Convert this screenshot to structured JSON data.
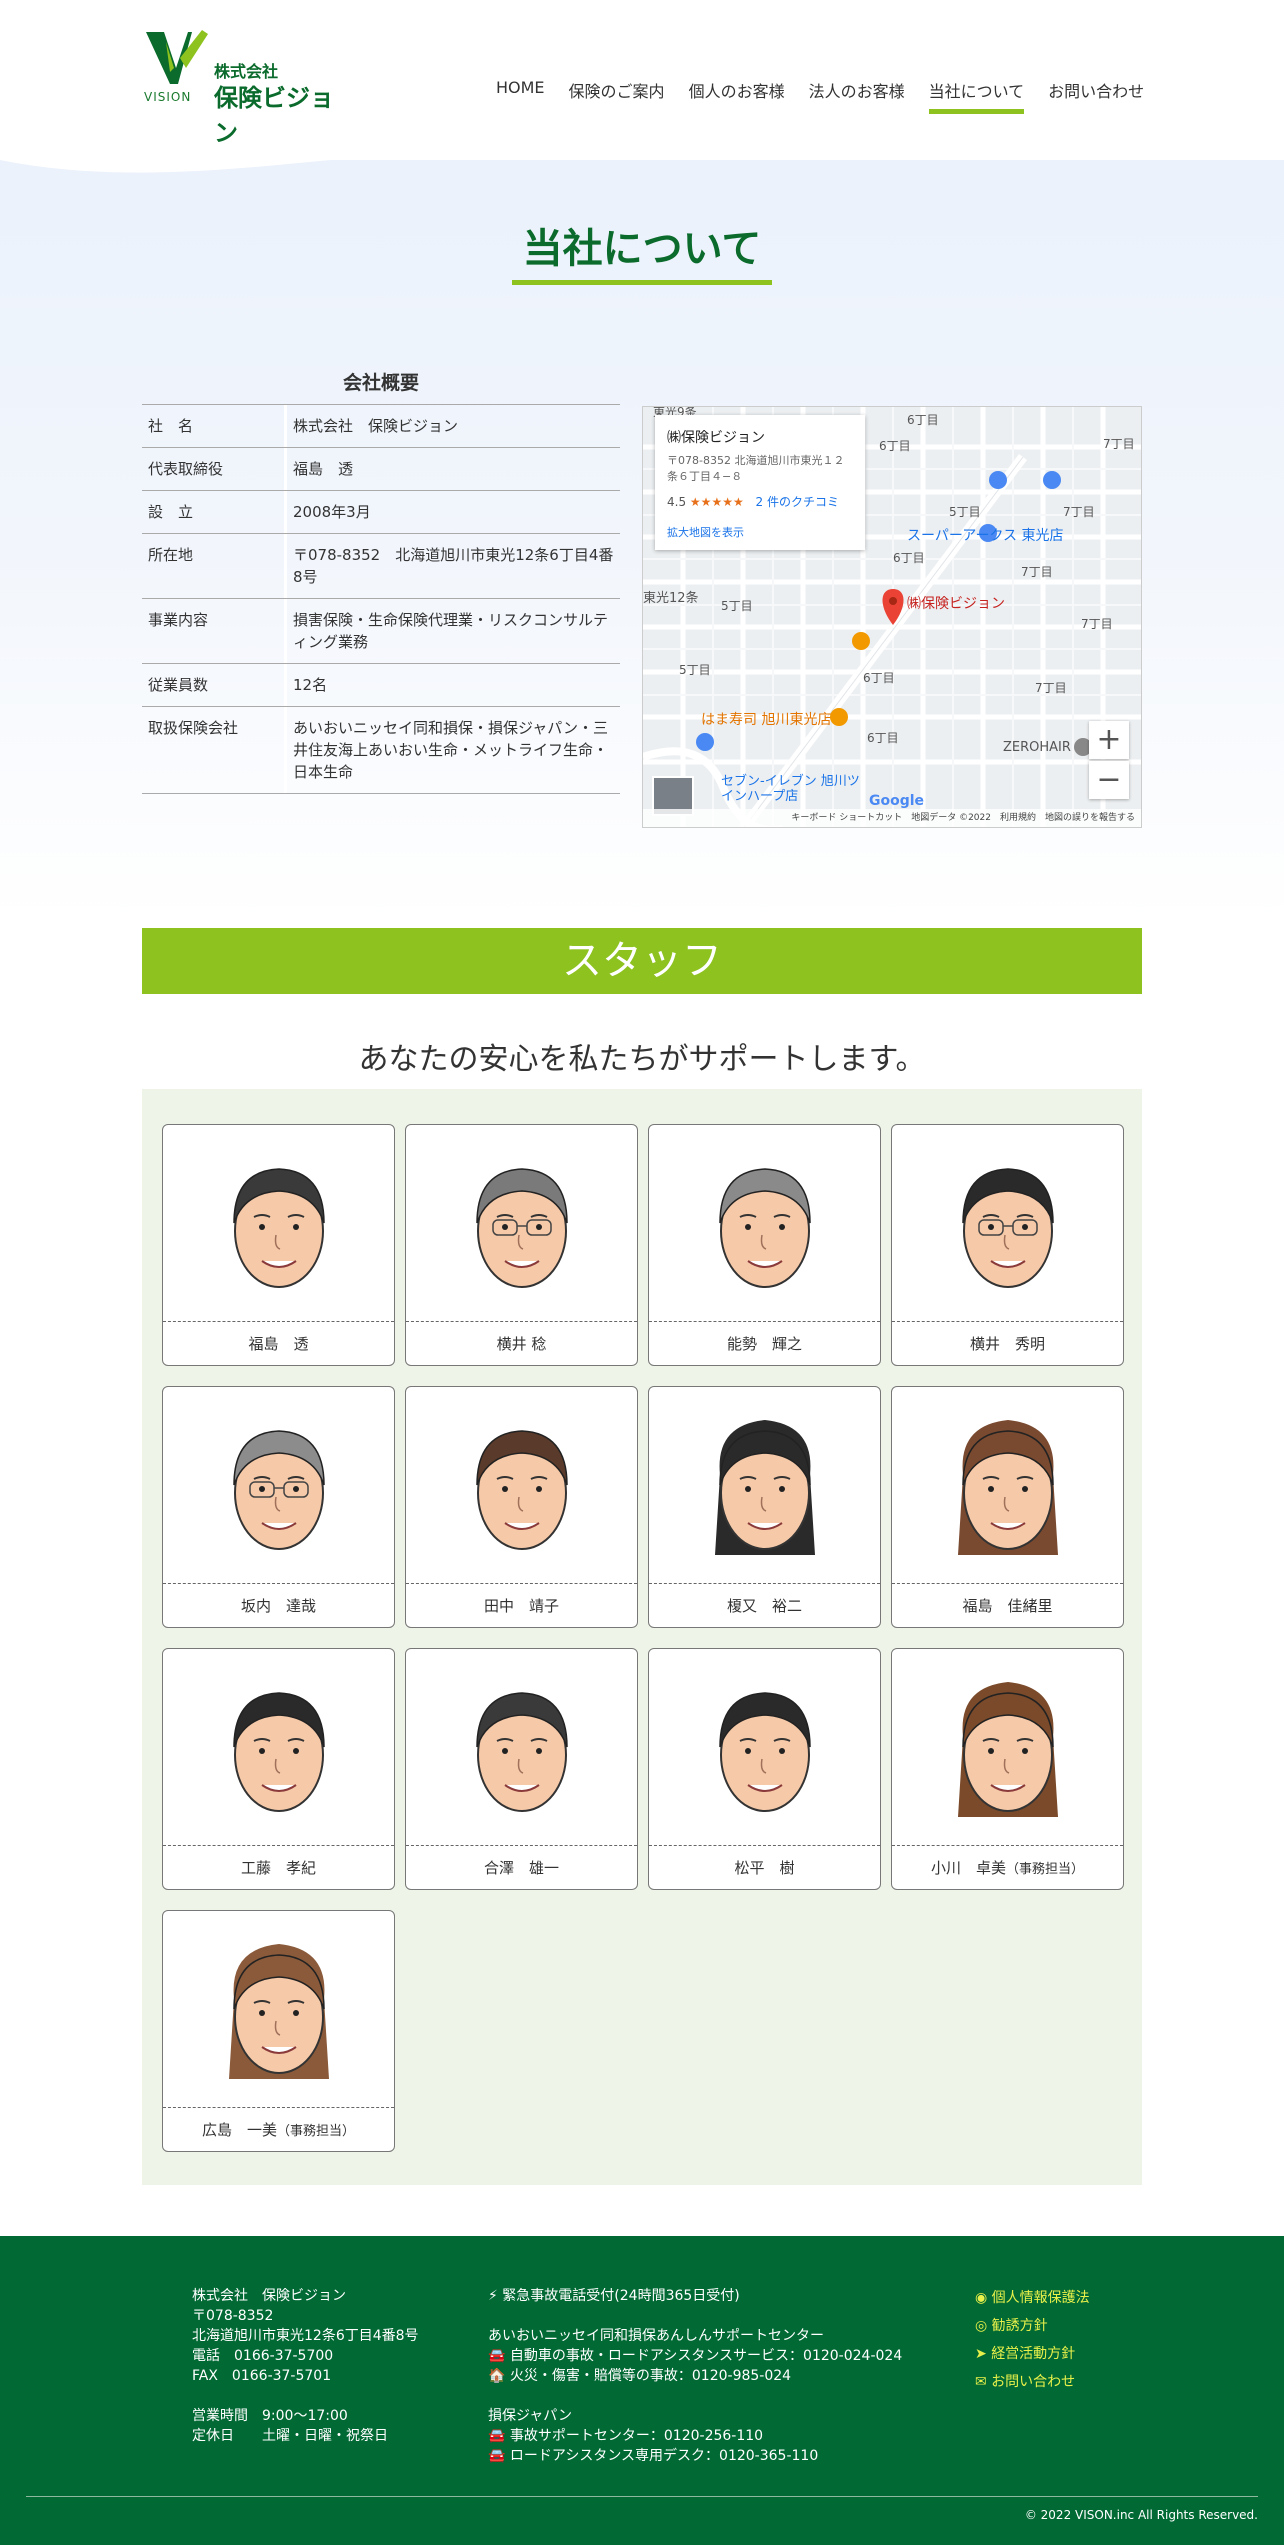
{
  "header": {
    "logo_sub": "VISION",
    "logo_company": "株式会社",
    "logo_name": "保険ビジョン",
    "nav": [
      "HOME",
      "保険のご案内",
      "個人のお客様",
      "法人のお客様",
      "当社について",
      "お問い合わせ"
    ],
    "active_nav": "当社について"
  },
  "page_title": "当社について",
  "overview": {
    "heading": "会社概要",
    "rows": [
      {
        "k": "社　名",
        "v": "株式会社　保険ビジョン"
      },
      {
        "k": "代表取締役",
        "v": "福島　透"
      },
      {
        "k": "設　立",
        "v": "2008年3月"
      },
      {
        "k": "所在地",
        "v": "〒078-8352　北海道旭川市東光12条6丁目4番8号"
      },
      {
        "k": "事業内容",
        "v": "損害保険・生命保険代理業・リスクコンサルティング業務"
      },
      {
        "k": "従業員数",
        "v": "12名"
      },
      {
        "k": "取扱保険会社",
        "v": "あいおいニッセイ同和損保・損保ジャパン・三井住友海上あいおい生命・メットライフ生命・日本生命"
      }
    ]
  },
  "map": {
    "place_name": "㈱保険ビジョン",
    "address": "〒078-8352 北海道旭川市東光１２条６丁目４−８",
    "rating": "4.5",
    "stars": "★★★★★",
    "reviews": "2 件のクチコミ",
    "enlarge": "拡大地図を表示",
    "pin_label": "㈱保険ビジョン",
    "labels": {
      "super": "スーパーアークス 東光店",
      "sushi": "はま寿司 旭川東光店",
      "seven": "セブン-イレブン 旭川ツインハープ店",
      "zero": "ZEROHAIR",
      "east12": "東光12条",
      "top": "東光9条",
      "c1": "6丁目",
      "c2": "7丁目",
      "c3": "6丁目",
      "c4": "7丁目",
      "c5": "5丁目",
      "c6": "6丁目",
      "c7": "7丁目",
      "c8": "5丁目",
      "c9": "6丁目",
      "c10": "7丁目",
      "c11": "6丁目",
      "c12": "5丁目",
      "c13": "7丁目"
    },
    "zoom_in": "+",
    "zoom_out": "−",
    "footer": "キーボード ショートカット　地図データ ©2022　利用規約　地図の誤りを報告する",
    "google": "Google"
  },
  "staff": {
    "banner": "スタッフ",
    "subtitle": "あなたの安心を私たちがサポートします。",
    "members": [
      {
        "name": "福島　透",
        "note": ""
      },
      {
        "name": "横井 稔",
        "note": ""
      },
      {
        "name": "能勢　輝之",
        "note": ""
      },
      {
        "name": "横井　秀明",
        "note": ""
      },
      {
        "name": "坂内　達哉",
        "note": ""
      },
      {
        "name": "田中　靖子",
        "note": ""
      },
      {
        "name": "榎又　裕二",
        "note": ""
      },
      {
        "name": "福島　佳緒里",
        "note": ""
      },
      {
        "name": "工藤　孝紀",
        "note": ""
      },
      {
        "name": "合澤　雄一",
        "note": ""
      },
      {
        "name": "松平　樹",
        "note": ""
      },
      {
        "name": "小川　卓美",
        "note": "（事務担当）"
      },
      {
        "name": "広島　一美",
        "note": "（事務担当）"
      }
    ]
  },
  "footer": {
    "company": "株式会社　保険ビジョン",
    "zip": "〒078-8352",
    "address": "北海道旭川市東光12条6丁目4番8号",
    "tel": "電話　0166-37-5700",
    "fax": "FAX　0166-37-5701",
    "hours": "営業時間　9:00〜17:00",
    "holiday": "定休日　　土曜・日曜・祝祭日",
    "emergency_title": "緊急事故電話受付(24時間365日受付)",
    "aioi_title": "あいおいニッセイ同和損保あんしんサポートセンター",
    "aioi_car": "自動車の事故・ロードアシスタンスサービス：0120-024-024",
    "aioi_fire": "火災・傷害・賠償等の事故：0120-985-024",
    "sompo_title": "損保ジャパン",
    "sompo_accident": "事故サポートセンター：0120-256-110",
    "sompo_road": "ロードアシスタンス専用デスク：0120-365-110",
    "links": [
      "個人情報保護法",
      "勧誘方針",
      "経営活動方針",
      "お問い合わせ"
    ],
    "copyright": "© 2022 VISON.inc All Rights Reserved."
  },
  "colors": {
    "accent": "#8dc21f",
    "brand": "#0a6b2c",
    "footer_bg": "#006934",
    "footer_link": "#e8f04a"
  }
}
